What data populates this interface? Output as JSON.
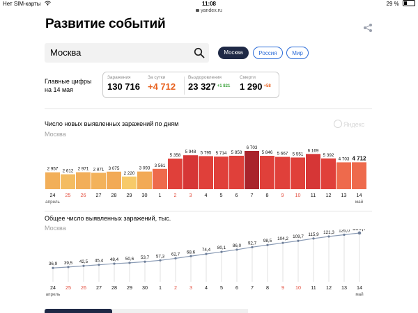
{
  "status_bar": {
    "carrier": "Нет SIM-карты",
    "time": "11:08",
    "battery": "29 %"
  },
  "url_bar": {
    "url": "yandex.ru"
  },
  "page": {
    "title": "Развитие событий"
  },
  "search": {
    "value": "Москва"
  },
  "region_tabs": [
    {
      "label": "Москва",
      "active": true
    },
    {
      "label": "Россия",
      "active": false
    },
    {
      "label": "Мир",
      "active": false
    }
  ],
  "key_figures": {
    "label_line1": "Главные цифры",
    "label_line2": "на 14 мая",
    "stats": [
      {
        "label": "Заражения",
        "value": "130 716",
        "delta": ""
      },
      {
        "label": "За сутки",
        "value": "+4 712",
        "delta": ""
      },
      {
        "label": "Выздоровления",
        "value": "23 327",
        "delta": "+1 821"
      },
      {
        "label": "Смерти",
        "value": "1 290",
        "delta": "+58"
      }
    ]
  },
  "watermark": "Яндекс",
  "colors": {
    "accent_orange": "#e8621f",
    "active_tab": "#1f2946",
    "link_blue": "#2a6bd8",
    "weekend_red": "#e34b3b",
    "green": "#3fa43f"
  },
  "chart_data": [
    {
      "type": "bar",
      "title": "Число новых выявленных заражений по дням",
      "subtitle": "Москва",
      "categories": [
        "24",
        "25",
        "26",
        "27",
        "28",
        "29",
        "30",
        "1",
        "2",
        "3",
        "4",
        "5",
        "6",
        "7",
        "8",
        "9",
        "10",
        "11",
        "12",
        "13",
        "14"
      ],
      "month_labels": [
        {
          "index": 0,
          "label": "апрель"
        },
        {
          "index": 20,
          "label": "май"
        }
      ],
      "weekend_indices": [
        1,
        2,
        8,
        9,
        15,
        16
      ],
      "values": [
        2957,
        2612,
        2971,
        2871,
        3075,
        2220,
        3093,
        3561,
        5358,
        5948,
        5795,
        5714,
        5858,
        6703,
        5846,
        5667,
        5551,
        6169,
        5392,
        4703,
        4712
      ],
      "value_labels": [
        "2 957",
        "2 612",
        "2 971",
        "2 871",
        "3 075",
        "2 220",
        "3 093",
        "3 561",
        "5 358",
        "5 948",
        "5 795",
        "5 714",
        "5 858",
        "6 703",
        "5 846",
        "5 667",
        "5 551",
        "6 169",
        "5 392",
        "4 703",
        "4 712"
      ]
    },
    {
      "type": "line",
      "title": "Общее число выявленных заражений, тыс.",
      "subtitle": "Москва",
      "categories": [
        "24",
        "25",
        "26",
        "27",
        "28",
        "29",
        "30",
        "1",
        "2",
        "3",
        "4",
        "5",
        "6",
        "7",
        "8",
        "9",
        "10",
        "11",
        "12",
        "13",
        "14"
      ],
      "month_labels": [
        {
          "index": 0,
          "label": "апрель"
        },
        {
          "index": 20,
          "label": "май"
        }
      ],
      "weekend_indices": [
        1,
        2,
        8,
        9,
        15,
        16
      ],
      "values": [
        36.9,
        39.5,
        42.5,
        45.4,
        48.4,
        50.6,
        53.7,
        57.3,
        62.7,
        68.6,
        74.4,
        80.1,
        86.0,
        92.7,
        98.5,
        104.2,
        109.7,
        115.9,
        121.3,
        126.0,
        130.7
      ],
      "value_labels": [
        "36,9",
        "39,5",
        "42,5",
        "45,4",
        "48,4",
        "50,6",
        "53,7",
        "57,3",
        "62,7",
        "68,6",
        "74,4",
        "80,1",
        "86,0",
        "92,7",
        "98,5",
        "104,2",
        "109,7",
        "115,9",
        "121,3",
        "126,0",
        "130,7"
      ]
    }
  ]
}
